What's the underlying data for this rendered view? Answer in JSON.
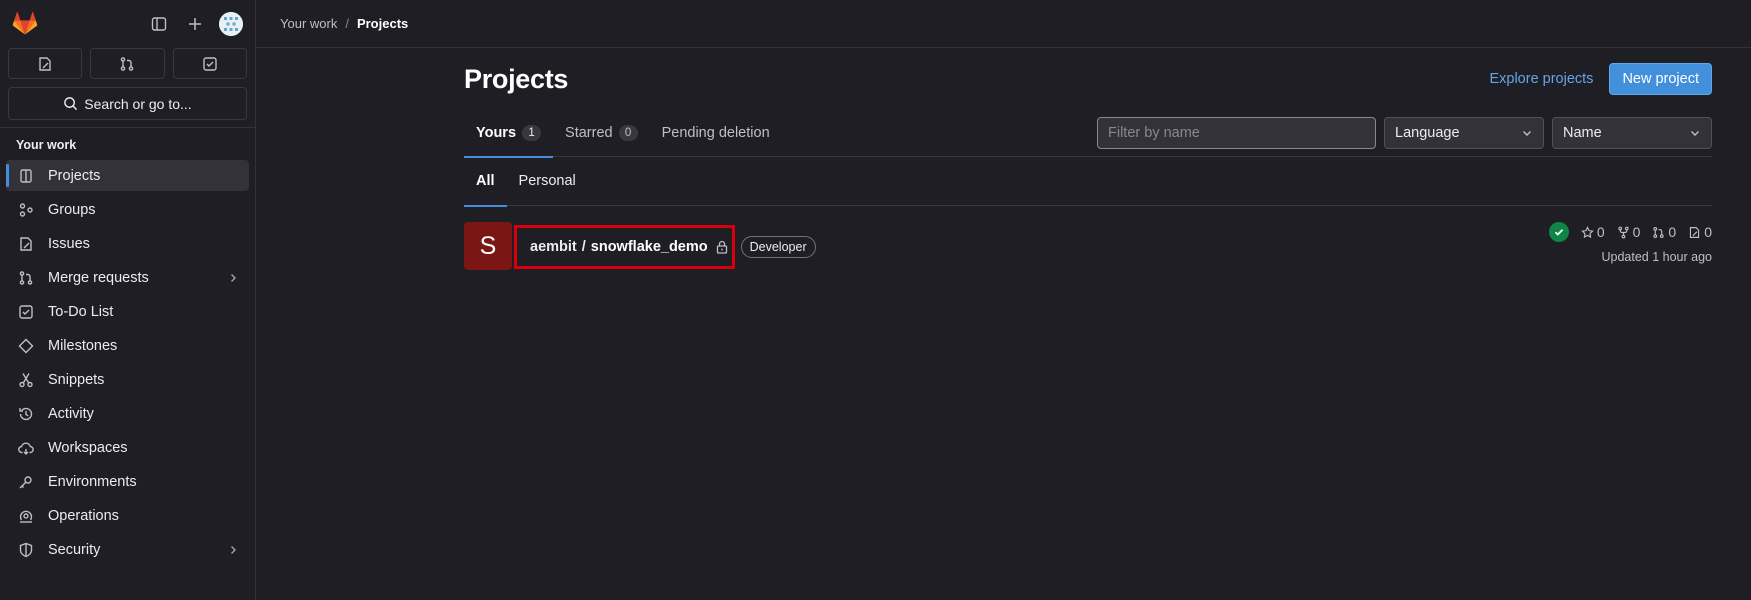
{
  "sidebar": {
    "section_title": "Your work",
    "search_label": "Search or go to...",
    "items": [
      {
        "label": "Projects",
        "icon": "project-icon",
        "active": true
      },
      {
        "label": "Groups",
        "icon": "group-icon"
      },
      {
        "label": "Issues",
        "icon": "issues-icon"
      },
      {
        "label": "Merge requests",
        "icon": "merge-request-icon",
        "has_children": true
      },
      {
        "label": "To-Do List",
        "icon": "todo-icon"
      },
      {
        "label": "Milestones",
        "icon": "milestone-icon"
      },
      {
        "label": "Snippets",
        "icon": "snippet-icon"
      },
      {
        "label": "Activity",
        "icon": "history-icon"
      },
      {
        "label": "Workspaces",
        "icon": "workspace-icon"
      },
      {
        "label": "Environments",
        "icon": "environment-icon"
      },
      {
        "label": "Operations",
        "icon": "operations-icon"
      },
      {
        "label": "Security",
        "icon": "shield-icon",
        "has_children": true
      }
    ]
  },
  "breadcrumb": {
    "parent": "Your work",
    "separator": "/",
    "current": "Projects"
  },
  "header": {
    "title": "Projects",
    "explore_label": "Explore projects",
    "new_label": "New project"
  },
  "tabs": [
    {
      "label": "Yours",
      "count": "1",
      "active": true
    },
    {
      "label": "Starred",
      "count": "0"
    },
    {
      "label": "Pending deletion"
    }
  ],
  "filters": {
    "search_placeholder": "Filter by name",
    "language": "Language",
    "sort": "Name"
  },
  "subtabs": [
    {
      "label": "All",
      "active": true
    },
    {
      "label": "Personal"
    }
  ],
  "projects": [
    {
      "avatar_letter": "S",
      "avatar_color": "#7a1613",
      "namespace": "aembit",
      "separator": "/",
      "name": "snowflake_demo",
      "role": "Developer",
      "stars": "0",
      "forks": "0",
      "merge_requests": "0",
      "issues": "0",
      "updated": "Updated 1 hour ago"
    }
  ],
  "colors": {
    "accent": "#428fdc",
    "highlight_box": "#d8000c",
    "pipeline_success": "#108548"
  }
}
